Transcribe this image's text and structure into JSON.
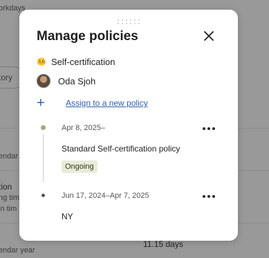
{
  "background": {
    "top_left": "orkdays",
    "tab_label": "tory",
    "row1": "endar",
    "section_title": "tion",
    "section_sub1": "ng tim",
    "section_sub2": "in tim",
    "footer_left": "endar year",
    "footer_value": "11.15 days"
  },
  "modal": {
    "title": "Manage policies",
    "policy_type": {
      "emoji": "🤒",
      "label": "Self-certification"
    },
    "employee": {
      "name": "Oda Sjoh"
    },
    "assign_link": "Assign to a new policy",
    "entries": [
      {
        "date": "Apr 8, 2025–",
        "name": "Standard Self-certification policy",
        "status": "Ongoing"
      },
      {
        "date": "Jun 17, 2024–Apr 7, 2025",
        "name": "NY"
      }
    ]
  },
  "colors": {
    "accent": "#2f5fb0",
    "badge_bg": "#e9ecd8",
    "active_dot": "#9daa7a",
    "overlay": "#999999"
  }
}
